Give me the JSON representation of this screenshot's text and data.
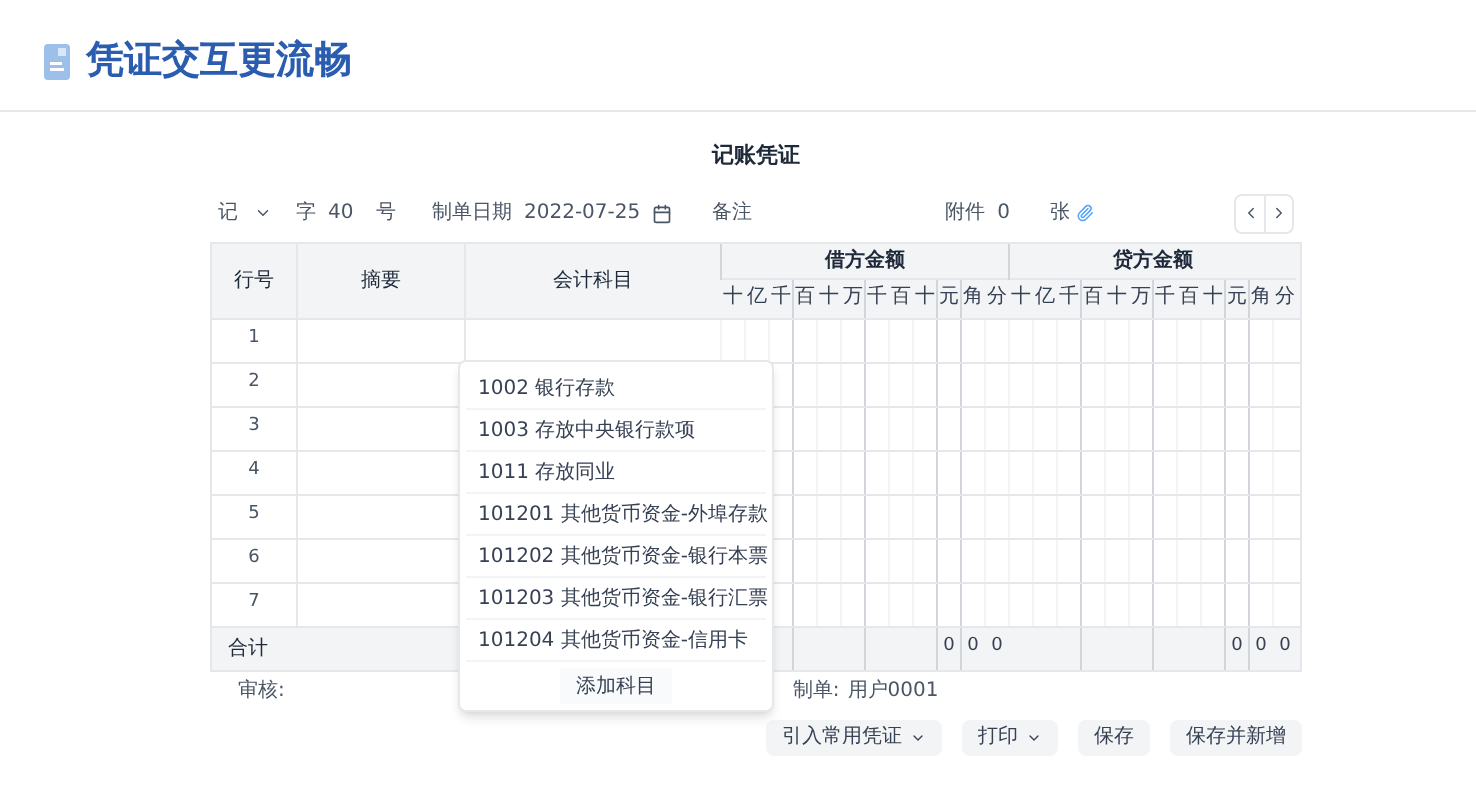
{
  "header": {
    "title": "凭证交互更流畅"
  },
  "voucher": {
    "title": "记账凭证",
    "toolbar": {
      "type_select": "记",
      "word": "字",
      "number": "40",
      "number_suffix": "号",
      "date_label": "制单日期",
      "date": "2022-07-25",
      "remark_label": "备注",
      "attachments_label": "附件",
      "attachments_count": "0",
      "attachments_unit": "张"
    },
    "table": {
      "columns": [
        "行号",
        "摘要",
        "会计科目"
      ],
      "debit": {
        "title": "借方金额",
        "units": [
          "十",
          "亿",
          "千",
          "百",
          "十",
          "万",
          "千",
          "百",
          "十",
          "元",
          "角",
          "分"
        ]
      },
      "credit": {
        "title": "贷方金额",
        "units": [
          "十",
          "亿",
          "千",
          "百",
          "十",
          "万",
          "千",
          "百",
          "十",
          "元",
          "角",
          "分"
        ]
      },
      "rows": [
        {
          "number": "1"
        },
        {
          "number": "2"
        },
        {
          "number": "3"
        },
        {
          "number": "4"
        },
        {
          "number": "5"
        },
        {
          "number": "6"
        },
        {
          "number": "7"
        }
      ],
      "total": {
        "label": "合计",
        "debit_digits": [
          "0",
          "0",
          "0"
        ],
        "credit_digits": [
          "0",
          "0",
          "0"
        ]
      }
    },
    "account_dropdown": {
      "items": [
        "1002 银行存款",
        "1003 存放中央银行款项",
        "1011 存放同业",
        "101201 其他货币资金-外埠存款",
        "101202 其他货币资金-银行本票",
        "101203 其他货币资金-银行汇票",
        "101204 其他货币资金-信用卡"
      ],
      "add_button": "添加科目"
    },
    "footer": {
      "reviewer_label": "审核:",
      "preparer_label": "制单:",
      "preparer": "用户0001"
    },
    "buttons": [
      {
        "label": "引入常用凭证",
        "dropdown": true
      },
      {
        "label": "打印",
        "dropdown": true
      },
      {
        "label": "保存",
        "dropdown": false
      },
      {
        "label": "保存并新增",
        "dropdown": false
      }
    ]
  }
}
